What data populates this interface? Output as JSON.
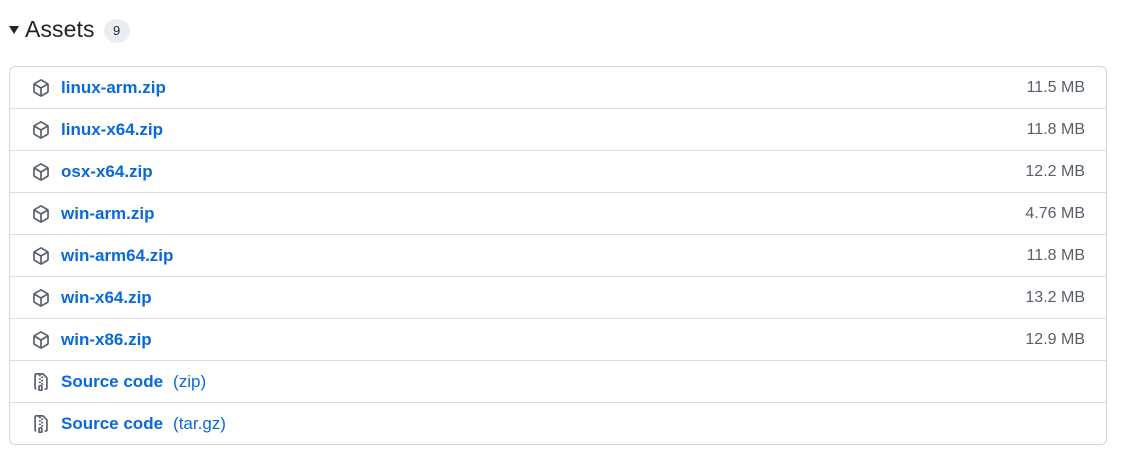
{
  "assets": {
    "title": "Assets",
    "count": "9",
    "toggle_icon": "triangle-down-icon",
    "items": [
      {
        "name": "linux-arm.zip",
        "size": "11.5 MB",
        "icon": "package-icon"
      },
      {
        "name": "linux-x64.zip",
        "size": "11.8 MB",
        "icon": "package-icon"
      },
      {
        "name": "osx-x64.zip",
        "size": "12.2 MB",
        "icon": "package-icon"
      },
      {
        "name": "win-arm.zip",
        "size": "4.76 MB",
        "icon": "package-icon"
      },
      {
        "name": "win-arm64.zip",
        "size": "11.8 MB",
        "icon": "package-icon"
      },
      {
        "name": "win-x64.zip",
        "size": "13.2 MB",
        "icon": "package-icon"
      },
      {
        "name": "win-x86.zip",
        "size": "12.9 MB",
        "icon": "package-icon"
      }
    ],
    "source_items": [
      {
        "name": "Source code",
        "suffix": "(zip)",
        "icon": "file-zip-icon"
      },
      {
        "name": "Source code",
        "suffix": "(tar.gz)",
        "icon": "file-zip-icon"
      }
    ]
  },
  "colors": {
    "link": "#0969da",
    "muted": "#57606a",
    "border": "#d0d7de",
    "badge_bg": "#eaeef2"
  }
}
